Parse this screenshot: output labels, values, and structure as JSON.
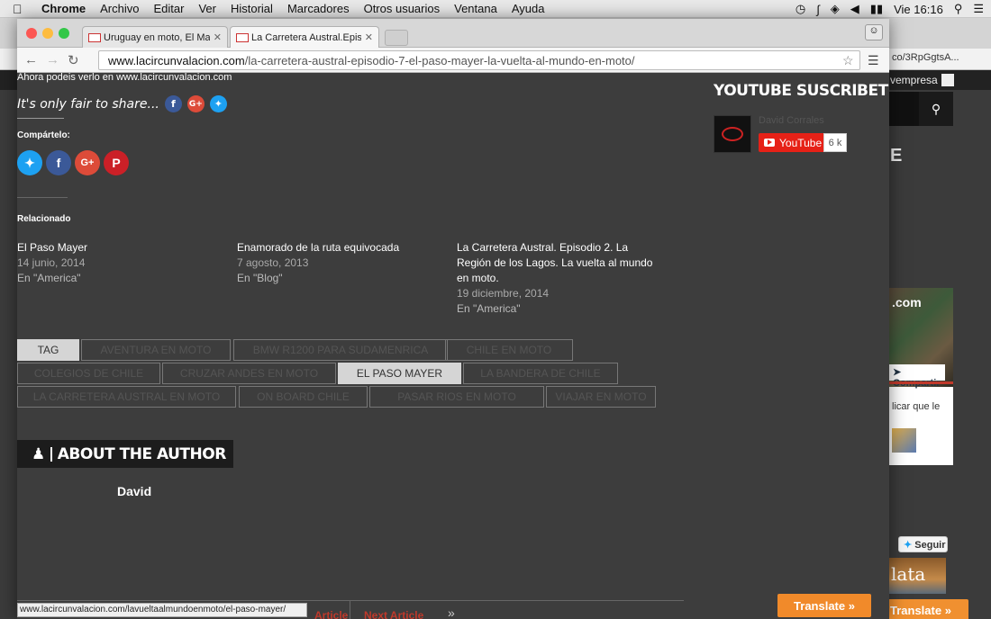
{
  "menubar": {
    "app": "Chrome",
    "items": [
      "Archivo",
      "Editar",
      "Ver",
      "Historial",
      "Marcadores",
      "Otros usuarios",
      "Ventana",
      "Ayuda"
    ],
    "clock": "Vie 16:16"
  },
  "background_window": {
    "url_fragment": "co/3RpGgtsA...",
    "empresa": "vempresa",
    "heading_fragment": "E",
    "com": ".com",
    "compartir": "Compartir",
    "licar": "licar que le",
    "seguir": "Seguir",
    "plata": "lata",
    "translate": "Translate »"
  },
  "tabs": [
    {
      "title": "Uruguay en moto, El Mar de",
      "active": false
    },
    {
      "title": "La Carretera Austral.Episod",
      "active": true
    }
  ],
  "address": {
    "domain": "www.lacircunvalacion.com",
    "path": "/la-carretera-austral-episodio-7-el-paso-mayer-la-vuelta-al-mundo-en-moto/"
  },
  "page": {
    "top_line": "Ahora podeis verlo en www.lacircunvalacion.com",
    "fair_share": "It's only fair to share...",
    "compartelo": "Compártelo:",
    "relacionado": "Relacionado",
    "related": [
      {
        "title": "El Paso Mayer",
        "date": "14 junio, 2014",
        "category": "En \"America\""
      },
      {
        "title": "Enamorado de la ruta equivocada",
        "date": "7 agosto, 2013",
        "category": "En \"Blog\""
      },
      {
        "title": "La Carretera Austral. Episodio 2. La Región de los Lagos. La vuelta al mundo en moto.",
        "date": "19 diciembre, 2014",
        "category": "En \"America\""
      }
    ],
    "tags": [
      "TAG",
      "AVENTURA EN MOTO",
      "BMW R1200 PARA SUDAMENRICA",
      "CHILE EN MOTO",
      "COLEGIOS DE CHILE",
      "CRUZAR ANDES EN MOTO",
      "EL PASO MAYER",
      "LA BANDERA DE CHILE",
      "LA CARRETERA AUSTRAL EN MOTO",
      "ON BOARD CHILE",
      "PASAR RIOS EN MOTO",
      "VIAJAR EN MOTO"
    ],
    "about_author": "ABOUT THE AUTHOR",
    "author_name": "David",
    "youtube_title": "YOUTUBE SUSCRIBETE",
    "youtube_channel": "David Corrales",
    "youtube_button": "YouTube",
    "youtube_count": "6 k",
    "footer_left": "Article",
    "footer_right": "Next Article",
    "status_url": "www.lacircunvalacion.com/lavueltaalmundoenmoto/el-paso-mayer/",
    "translate": "Translate »"
  },
  "colors": {
    "accent_red": "#c0392b",
    "youtube_red": "#e62117",
    "translate_orange": "#f18a2a",
    "page_bg": "#3d3d3d"
  }
}
